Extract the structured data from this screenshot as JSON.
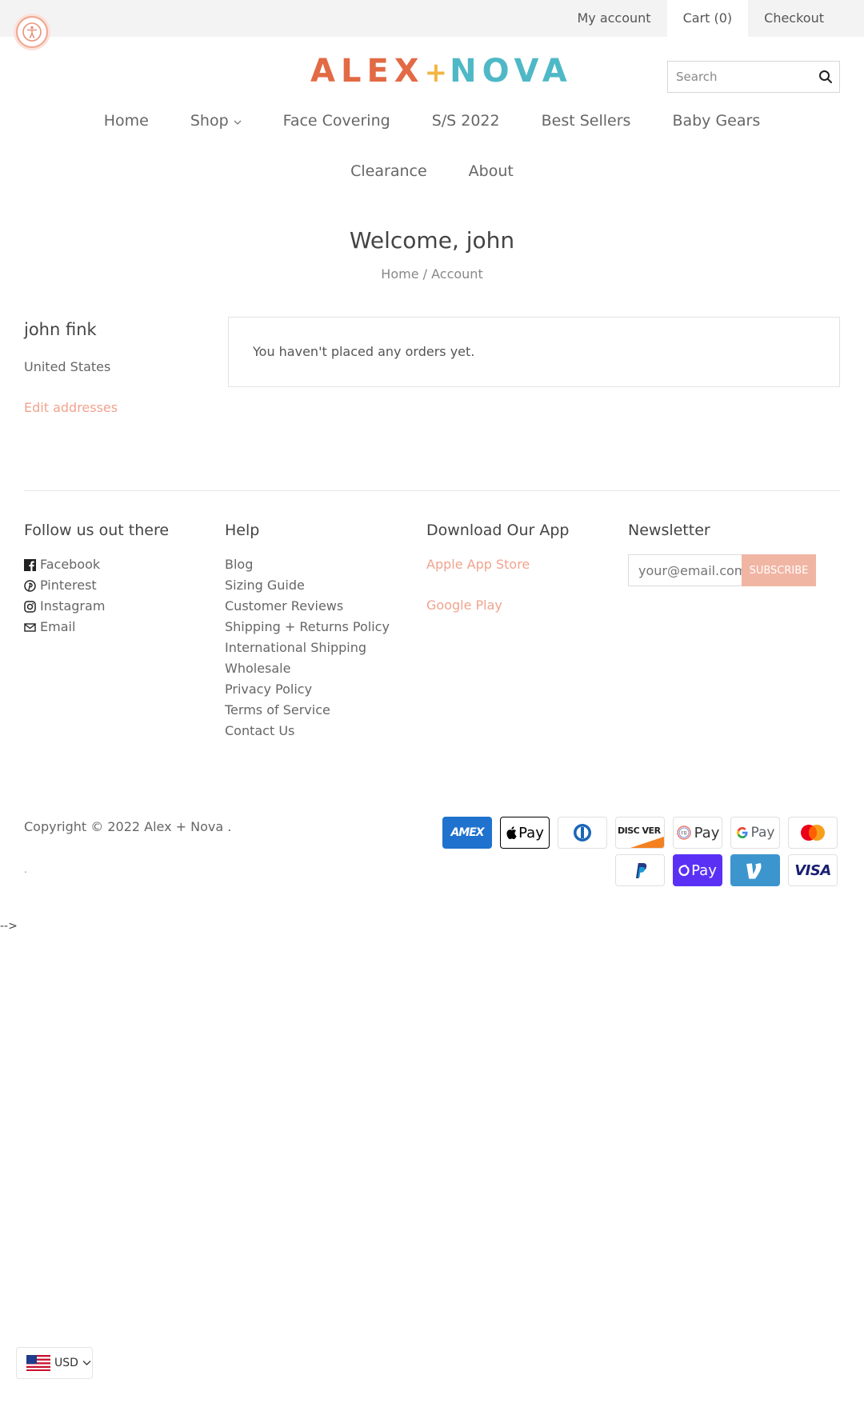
{
  "topbar": {
    "my_account": "My account",
    "cart": "Cart (0)",
    "checkout": "Checkout"
  },
  "logo": {
    "part1": "ALEX",
    "plus": "+",
    "part2": "NOVA"
  },
  "search": {
    "placeholder": "Search"
  },
  "nav": {
    "row1": [
      "Home",
      "Shop",
      "Face Covering",
      "S/S 2022",
      "Best Sellers",
      "Baby Gears"
    ],
    "row2": [
      "Clearance",
      "About"
    ]
  },
  "welcome": "Welcome, john",
  "breadcrumb": {
    "home": "Home",
    "sep": "/",
    "current": "Account"
  },
  "account": {
    "name": "john fink",
    "country": "United States",
    "edit_addresses": "Edit addresses",
    "orders_message": "You haven't placed any orders yet."
  },
  "footer": {
    "follow": {
      "title": "Follow us out there",
      "links": [
        "Facebook",
        "Pinterest",
        "Instagram",
        "Email"
      ]
    },
    "help": {
      "title": "Help",
      "links": [
        "Blog",
        "Sizing Guide",
        "Customer Reviews",
        "Shipping + Returns Policy",
        "International Shipping",
        "Wholesale",
        "Privacy Policy",
        "Terms of Service",
        "Contact Us"
      ]
    },
    "app": {
      "title": "Download Our App",
      "links": [
        "Apple App Store",
        "Google Play"
      ]
    },
    "newsletter": {
      "title": "Newsletter",
      "placeholder": "your@email.com",
      "button": "SUBSCRIBE"
    }
  },
  "copyright": "Copyright © 2022 Alex + Nova .",
  "dot": ".",
  "comment_end": "-->",
  "payments": {
    "amex": "AMEX",
    "apple_pay": "Pay",
    "discover": "DISC VER",
    "fb_pay": "Pay",
    "google_pay": "Pay",
    "shop_pay": "Pay",
    "visa": "VISA"
  },
  "currency": {
    "code": "USD"
  },
  "colors": {
    "accent": "#f1a38e",
    "logo_orange": "#e26a45",
    "logo_teal": "#4fb8c6",
    "logo_plus": "#f2b544"
  }
}
